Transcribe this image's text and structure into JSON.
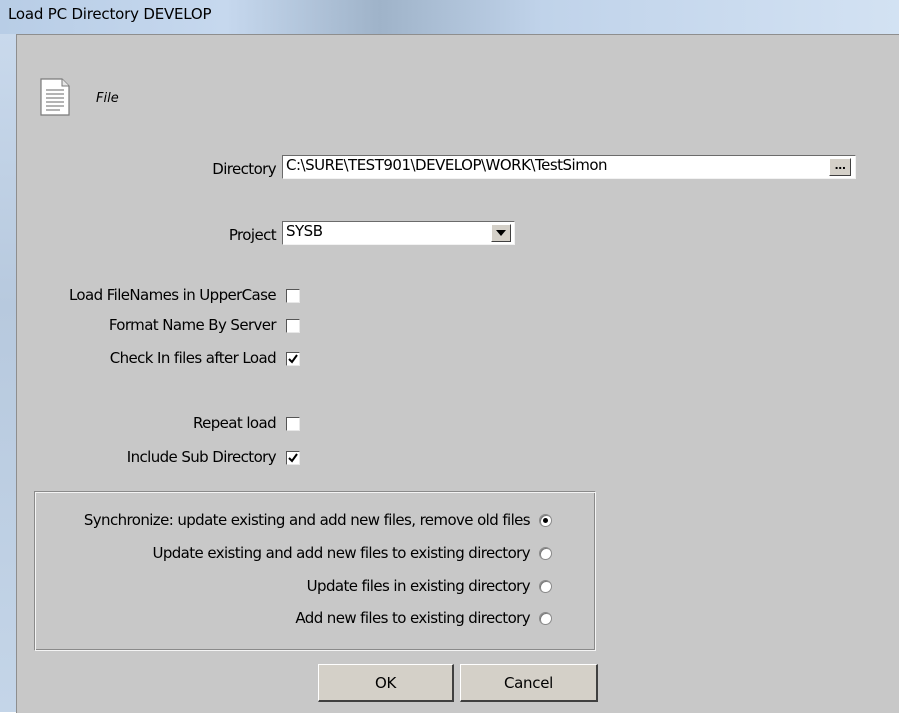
{
  "window": {
    "title": "Load PC Directory DEVELOP"
  },
  "header": {
    "icon": "document-icon",
    "label": "File"
  },
  "form": {
    "directory_label": "Directory",
    "directory_value": "C:\\SURE\\TEST901\\DEVELOP\\WORK\\TestSimon",
    "browse_label": "...",
    "project_label": "Project",
    "project_value": "SYSB",
    "options": [
      {
        "label": "Load FileNames in UpperCase",
        "checked": false
      },
      {
        "label": "Format Name By Server",
        "checked": false
      },
      {
        "label": "Check In files after Load",
        "checked": true
      },
      {
        "label": "Repeat load",
        "checked": false
      },
      {
        "label": "Include Sub Directory",
        "checked": true
      }
    ]
  },
  "sync_modes": [
    {
      "label": "Synchronize: update existing and add new files, remove old files",
      "selected": true
    },
    {
      "label": "Update existing and add new files to existing directory",
      "selected": false
    },
    {
      "label": "Update files in existing directory",
      "selected": false
    },
    {
      "label": "Add new files to existing directory",
      "selected": false
    }
  ],
  "buttons": {
    "ok": "OK",
    "cancel": "Cancel"
  }
}
